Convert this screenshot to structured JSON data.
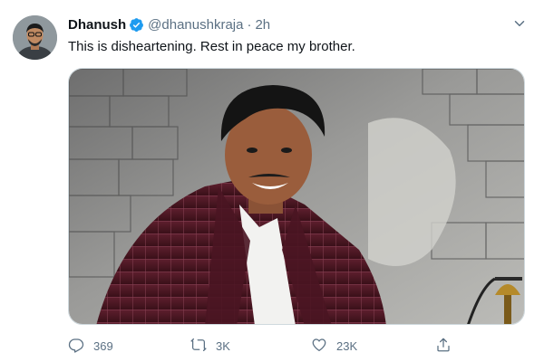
{
  "author": {
    "name": "Dhanush",
    "handle": "@dhanushkraja",
    "separator": "·",
    "time": "2h",
    "verified_icon": "verified-badge-icon",
    "avatar_icon": "avatar"
  },
  "tweet": {
    "text": "This is disheartening. Rest in peace my brother.",
    "image_description_icon": "portrait-photo"
  },
  "actions": {
    "reply_count": "369",
    "retweet_count": "3K",
    "like_count": "23K",
    "reply_icon": "reply-icon",
    "retweet_icon": "retweet-icon",
    "like_icon": "heart-icon",
    "share_icon": "share-icon"
  },
  "colors": {
    "text": "#0f1419",
    "secondary": "#5b7083",
    "verified": "#1d9bf0",
    "border": "#cfd9de"
  }
}
